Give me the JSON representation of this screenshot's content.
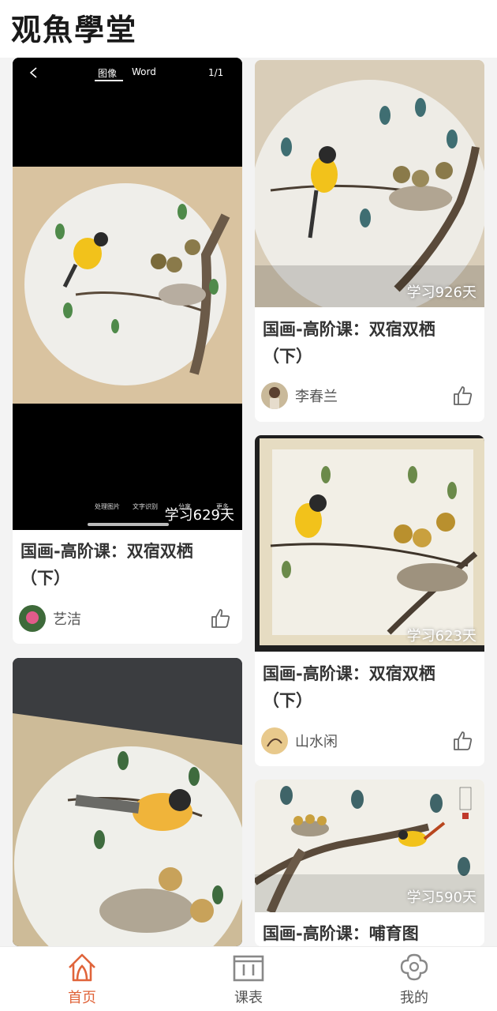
{
  "header": {
    "logo_text": "观魚學堂"
  },
  "cards": [
    {
      "title": "国画-高阶课：双宿双栖（下）",
      "days": "学习629天",
      "author": "艺洁",
      "viewer": {
        "back_icon": "chevron-left-icon",
        "tab_image": "图像",
        "tab_word": "Word",
        "page_counter": "1/1",
        "tools": [
          "处理图片",
          "文字识别",
          "分享",
          "更多"
        ]
      }
    },
    {
      "title": "国画-高阶课：双宿双栖（下）",
      "days": "学习926天",
      "author": "李春兰"
    },
    {
      "title": "国画-高阶课：双宿双栖（下）",
      "days": "学习623天",
      "author": "山水闲"
    },
    {
      "title": "国画-高阶课：哺育图",
      "days": "学习590天",
      "author": ""
    },
    {
      "title": "",
      "days": "",
      "author": ""
    }
  ],
  "tabbar": {
    "items": [
      {
        "label": "首页",
        "icon": "home-icon",
        "active": true
      },
      {
        "label": "课表",
        "icon": "schedule-icon",
        "active": false
      },
      {
        "label": "我的",
        "icon": "profile-icon",
        "active": false
      }
    ]
  },
  "colors": {
    "accent": "#e0643a",
    "bird_yellow": "#f2c21b",
    "background": "#f3f3f3"
  }
}
